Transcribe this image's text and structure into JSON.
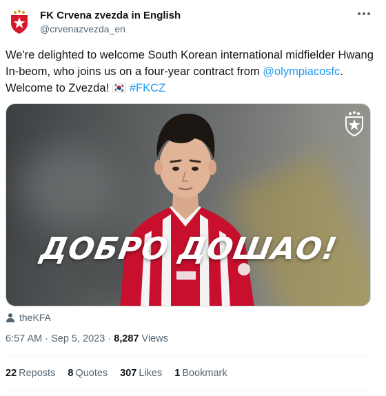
{
  "account": {
    "name": "FK Crvena zvezda in English",
    "handle": "@crvenazvezda_en"
  },
  "tweet": {
    "text_1": "We're delighted to welcome South Korean international midfielder Hwang In-beom, who joins us on a four-year contract from ",
    "mention": "@olympiacosfc",
    "text_2": ". Welcome to Zvezda! ",
    "flag": "🇰🇷",
    "hashtag": "#FKCZ"
  },
  "media": {
    "overlay_text": "ДОБРО ДОШАО!",
    "credit": "theKFA"
  },
  "meta": {
    "time": "6:57 AM",
    "separator": " · ",
    "date": "Sep 5, 2023",
    "views_count": "8,287",
    "views_label": "Views"
  },
  "stats": {
    "reposts_count": "22",
    "reposts_label": "Reposts",
    "quotes_count": "8",
    "quotes_label": "Quotes",
    "likes_count": "307",
    "likes_label": "Likes",
    "bookmarks_count": "1",
    "bookmarks_label": "Bookmark"
  },
  "colors": {
    "link": "#1d9bf0",
    "secondary_text": "#536471",
    "primary_text": "#0f1419",
    "club_red": "#d7182a"
  }
}
